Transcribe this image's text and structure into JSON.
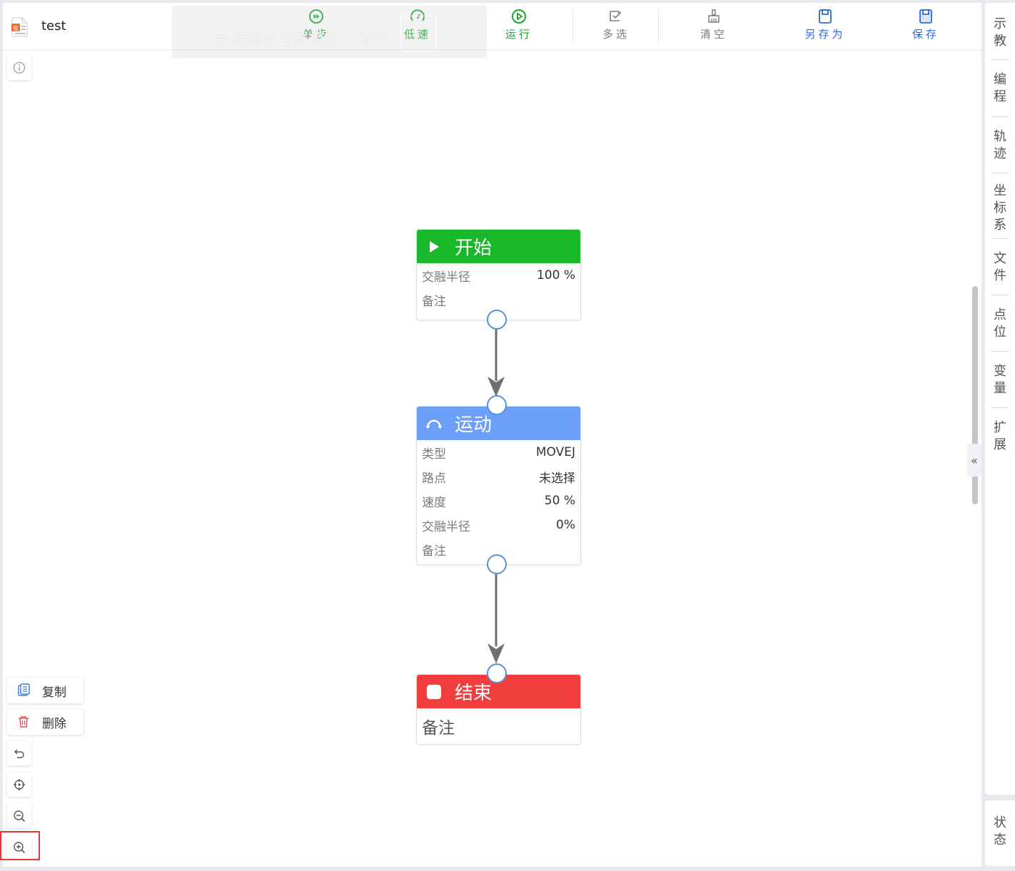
{
  "file": {
    "title": "test"
  },
  "fullscreen_toast": {
    "text": "若要退出全屏模式，请按"
  },
  "toolbar": {
    "step": "单步",
    "low_speed": "低速",
    "run": "运行",
    "multi_select": "多选",
    "clear": "清空",
    "save_as": "另存为",
    "save": "保存"
  },
  "flow": {
    "start": {
      "title": "开始",
      "rows": [
        {
          "k": "交融半径",
          "v": "100 %"
        },
        {
          "k": "备注",
          "v": ""
        }
      ],
      "color": "#18b82a"
    },
    "motion": {
      "title": "运动",
      "rows": [
        {
          "k": "类型",
          "v": "MOVEJ"
        },
        {
          "k": "路点",
          "v": "未选择"
        },
        {
          "k": "速度",
          "v": "50 %"
        },
        {
          "k": "交融半径",
          "v": "0%"
        },
        {
          "k": "备注",
          "v": ""
        }
      ],
      "color": "#6c9ff7"
    },
    "end": {
      "title": "结束",
      "remark": "备注",
      "color": "#f23d3d"
    }
  },
  "tools": {
    "copy": "复制",
    "delete": "删除"
  },
  "right_nav": {
    "items": [
      {
        "l1": "示",
        "l2": "教"
      },
      {
        "l1": "编",
        "l2": "程"
      },
      {
        "l1": "轨",
        "l2": "迹"
      },
      {
        "l1": "坐",
        "l2": "标",
        "l3": "系"
      },
      {
        "l1": "文",
        "l2": "件"
      },
      {
        "l1": "点",
        "l2": "位"
      },
      {
        "l1": "变",
        "l2": "量"
      },
      {
        "l1": "扩",
        "l2": "展"
      }
    ],
    "status": {
      "l1": "状",
      "l2": "态"
    },
    "collapse": "«"
  }
}
